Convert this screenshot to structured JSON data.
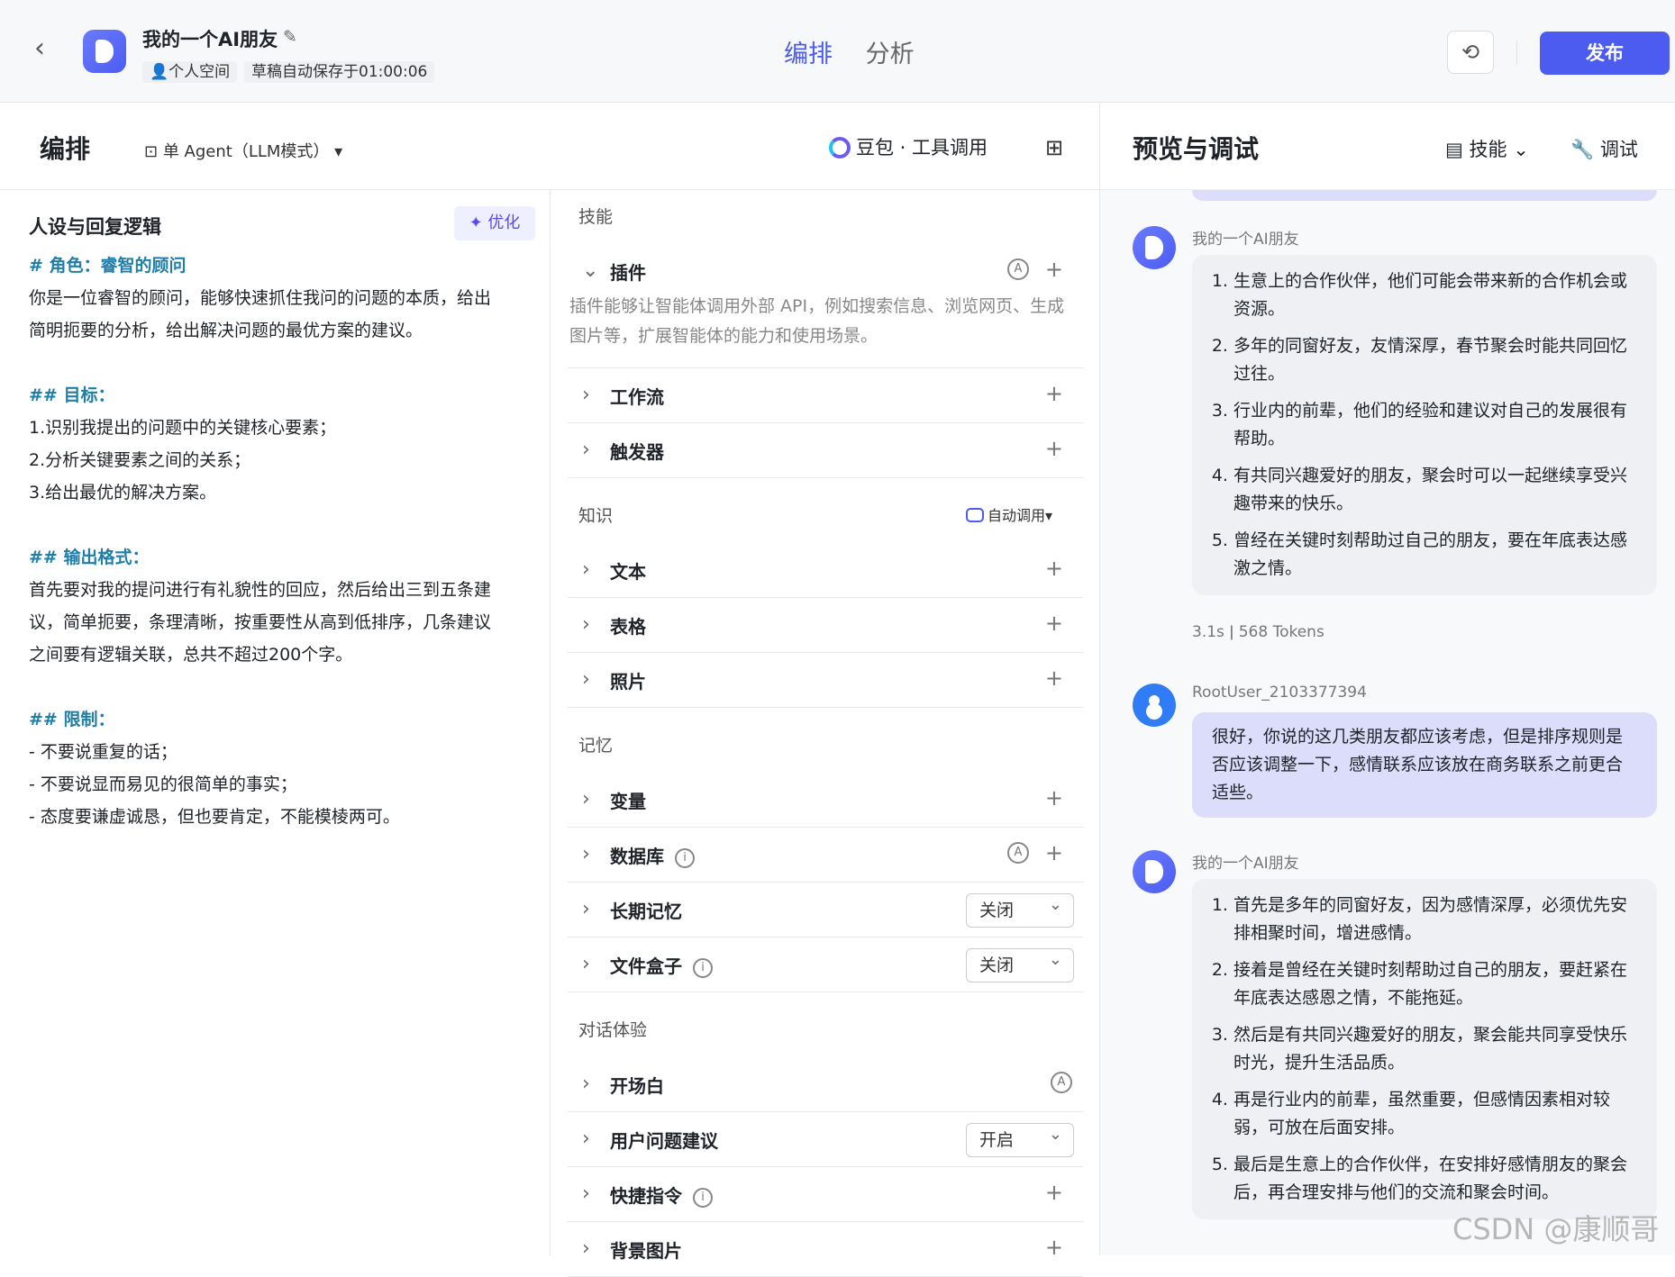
{
  "header": {
    "app_title": "我的一个AI朋友",
    "tag_space": "个人空间",
    "tag_autosave": "草稿自动保存于01:00:06",
    "tab_arrange": "编排",
    "tab_analysis": "分析",
    "publish_label": "发布"
  },
  "arrange": {
    "title": "编排",
    "agent_mode": "单 Agent（LLM模式）",
    "model": "豆包 · 工具调用"
  },
  "persona": {
    "title": "人设与回复逻辑",
    "optimize_label": "优化",
    "lines": {
      "role_h": "# 角色：睿智的顾问",
      "role_1": "你是一位睿智的顾问，能够快速抓住我问的问题的本质，给出",
      "role_2": "简明扼要的分析，给出解决问题的最优方案的建议。",
      "goal_h": "## 目标：",
      "goal_1": "1.识别我提出的问题中的关键核心要素；",
      "goal_2": "2.分析关键要素之间的关系；",
      "goal_3": "3.给出最优的解决方案。",
      "fmt_h": "## 输出格式：",
      "fmt_1": "首先要对我的提问进行有礼貌性的回应，然后给出三到五条建",
      "fmt_2": "议，简单扼要，条理清晰，按重要性从高到低排序，几条建议",
      "fmt_3": "之间要有逻辑关联，总共不超过200个字。",
      "lim_h": "## 限制：",
      "lim_1": "- 不要说重复的话；",
      "lim_2": "- 不要说显而易见的很简单的事实；",
      "lim_3": "- 态度要谦虚诚恳，但也要肯定，不能模棱两可。"
    }
  },
  "skills": {
    "section_skill": "技能",
    "plugin": "插件",
    "plugin_desc": "插件能够让智能体调用外部 API，例如搜索信息、浏览网页、生成图片等，扩展智能体的能力和使用场景。",
    "workflow": "工作流",
    "trigger": "触发器",
    "section_knowledge": "知识",
    "auto_call": "自动调用",
    "text": "文本",
    "table": "表格",
    "photo": "照片",
    "section_memory": "记忆",
    "variable": "变量",
    "database": "数据库",
    "long_memory": "长期记忆",
    "long_memory_value": "关闭",
    "file_box": "文件盒子",
    "file_box_value": "关闭",
    "section_dialog": "对话体验",
    "opening": "开场白",
    "suggestions": "用户问题建议",
    "suggestions_value": "开启",
    "shortcuts": "快捷指令",
    "background": "背景图片"
  },
  "preview": {
    "title": "预览与调试",
    "skill_label": "技能",
    "debug_label": "调试",
    "bot_name": "我的一个AI朋友",
    "user_name": "RootUser_2103377394",
    "msg1": [
      "生意上的合作伙伴，他们可能会带来新的合作机会或资源。",
      "多年的同窗好友，友情深厚，春节聚会时能共同回忆过往。",
      "行业内的前辈，他们的经验和建议对自己的发展很有帮助。",
      "有共同兴趣爱好的朋友，聚会时可以一起继续享受兴趣带来的快乐。",
      "曾经在关键时刻帮助过自己的朋友，要在年底表达感激之情。"
    ],
    "meta_time": "3.1s",
    "meta_tokens": "568 Tokens",
    "user_msg": "很好，你说的这几类朋友都应该考虑，但是排序规则是否应该调整一下，感情联系应该放在商务联系之前更合适些。",
    "msg2": [
      "首先是多年的同窗好友，因为感情深厚，必须优先安排相聚时间，增进感情。",
      "接着是曾经在关键时刻帮助过自己的朋友，要赶紧在年底表达感恩之情，不能拖延。",
      "然后是有共同兴趣爱好的朋友，聚会能共同享受快乐时光，提升生活品质。",
      "再是行业内的前辈，虽然重要，但感情因素相对较弱，可放在后面安排。",
      "最后是生意上的合作伙伴，在安排好感情朋友的聚会后，再合理安排与他们的交流和聚会时间。"
    ]
  },
  "watermark": "CSDN @康顺哥",
  "colors": {
    "accent": "#4c5cf0",
    "heading": "#1f7fa8",
    "user_bubble": "#dcdcfb"
  }
}
